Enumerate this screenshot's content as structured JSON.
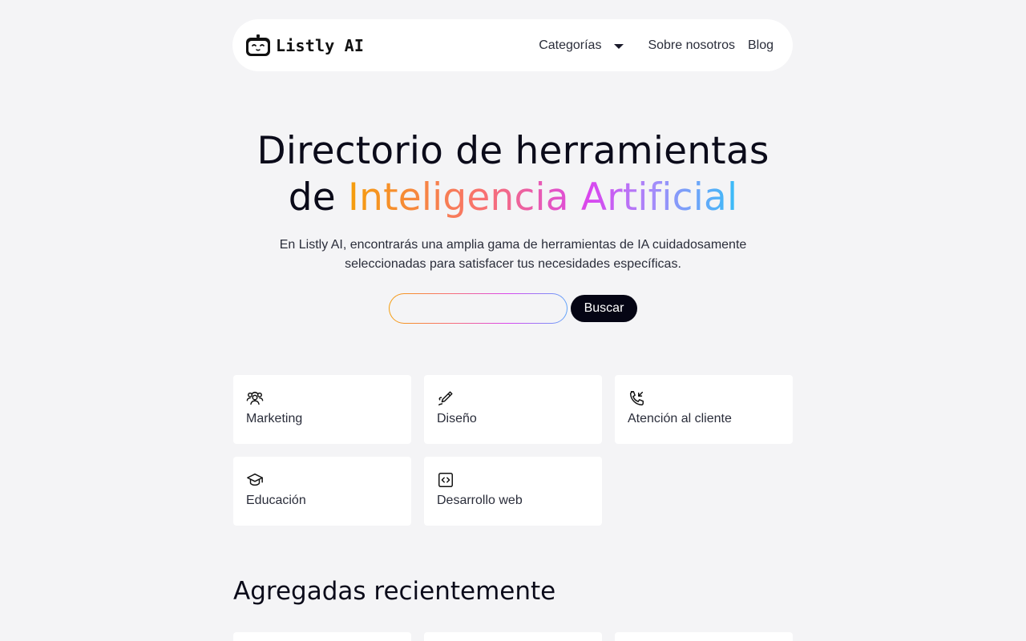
{
  "brand": {
    "name": "Listly AI"
  },
  "nav": {
    "categories_label": "Categorías",
    "about_label": "Sobre nosotros",
    "blog_label": "Blog"
  },
  "hero": {
    "title_line1": "Directorio de herramientas",
    "title_prefix": "de ",
    "title_highlight": "Inteligencia Artificial",
    "subtitle": "En Listly AI, encontrarás una amplia gama de herramientas de IA cuidadosamente seleccionadas para satisfacer tus necesidades específicas."
  },
  "search": {
    "value": "",
    "placeholder": "",
    "button_label": "Buscar"
  },
  "categories": [
    {
      "label": "Marketing",
      "icon": "users-icon"
    },
    {
      "label": "Diseño",
      "icon": "pen-icon"
    },
    {
      "label": "Atención al cliente",
      "icon": "phone-incoming-icon"
    },
    {
      "label": "Educación",
      "icon": "graduation-cap-icon"
    },
    {
      "label": "Desarrollo web",
      "icon": "code-icon"
    }
  ],
  "recent": {
    "title": "Agregadas recientemente"
  },
  "colors": {
    "background": "#f4f4f6",
    "button_dark": "#050514",
    "gradient": [
      "#f59e0b",
      "#f87171",
      "#d946ef",
      "#a78bfa",
      "#38bdf8"
    ]
  }
}
